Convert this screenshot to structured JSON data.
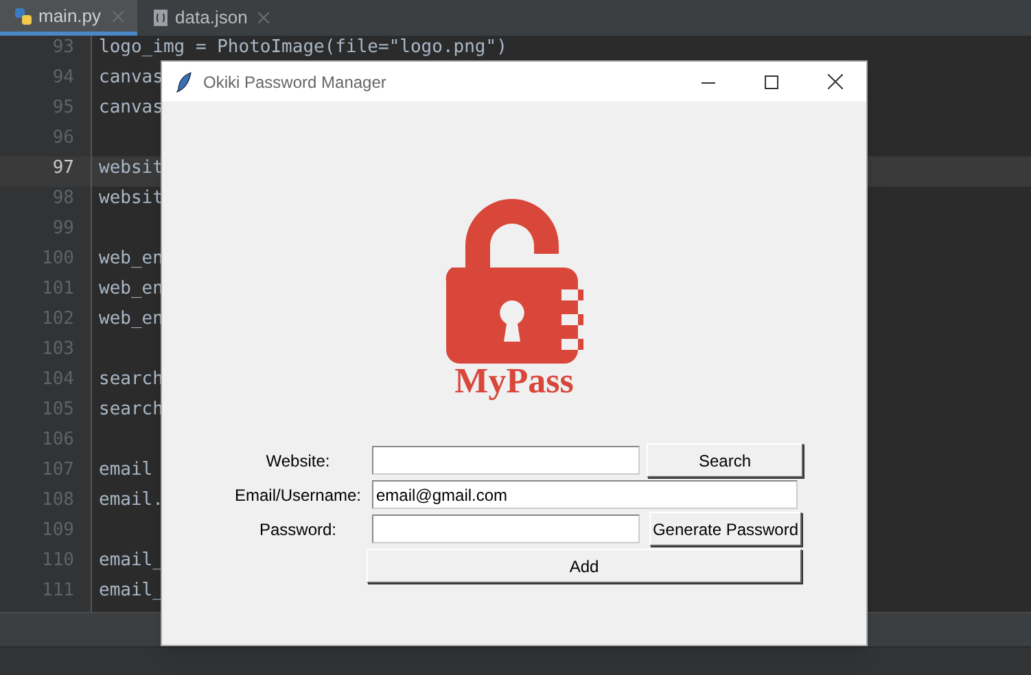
{
  "editor_tabs": [
    {
      "label": "main.py",
      "kind": "python",
      "selected": true
    },
    {
      "label": "data.json",
      "kind": "json",
      "selected": false
    }
  ],
  "code_lines": [
    {
      "number": "93",
      "text": "logo_img = PhotoImage(file=\"logo.png\")",
      "current": false
    },
    {
      "number": "94",
      "text": "canvas",
      "current": false
    },
    {
      "number": "95",
      "text": "canvas",
      "current": false
    },
    {
      "number": "96",
      "current": false
    },
    {
      "number": "97",
      "text": "websit",
      "current": true
    },
    {
      "number": "98",
      "text": "websit",
      "current": false
    },
    {
      "number": "99",
      "current": false
    },
    {
      "number": "100",
      "text": "web_en",
      "current": false
    },
    {
      "number": "101",
      "text": "web_en",
      "current": false
    },
    {
      "number": "102",
      "text": "web_en",
      "current": false
    },
    {
      "number": "103",
      "current": false
    },
    {
      "number": "104",
      "text": "search",
      "current": false
    },
    {
      "number": "105",
      "text": "search",
      "current": false
    },
    {
      "number": "106",
      "current": false
    },
    {
      "number": "107",
      "text": "email",
      "current": false
    },
    {
      "number": "108",
      "text": "email.",
      "current": false
    },
    {
      "number": "109",
      "current": false
    },
    {
      "number": "110",
      "text": "email_",
      "current": false
    },
    {
      "number": "111",
      "text": "email_",
      "current": false
    }
  ],
  "window": {
    "title": "Okiki Password Manager",
    "logo_text": "MyPass",
    "form": {
      "website_label": "Website:",
      "search_button": "Search",
      "email_label": "Email/Username:",
      "email_value": "email@gmail.com",
      "password_label": "Password:",
      "generate_button": "Generate Password",
      "add_button": "Add"
    }
  }
}
